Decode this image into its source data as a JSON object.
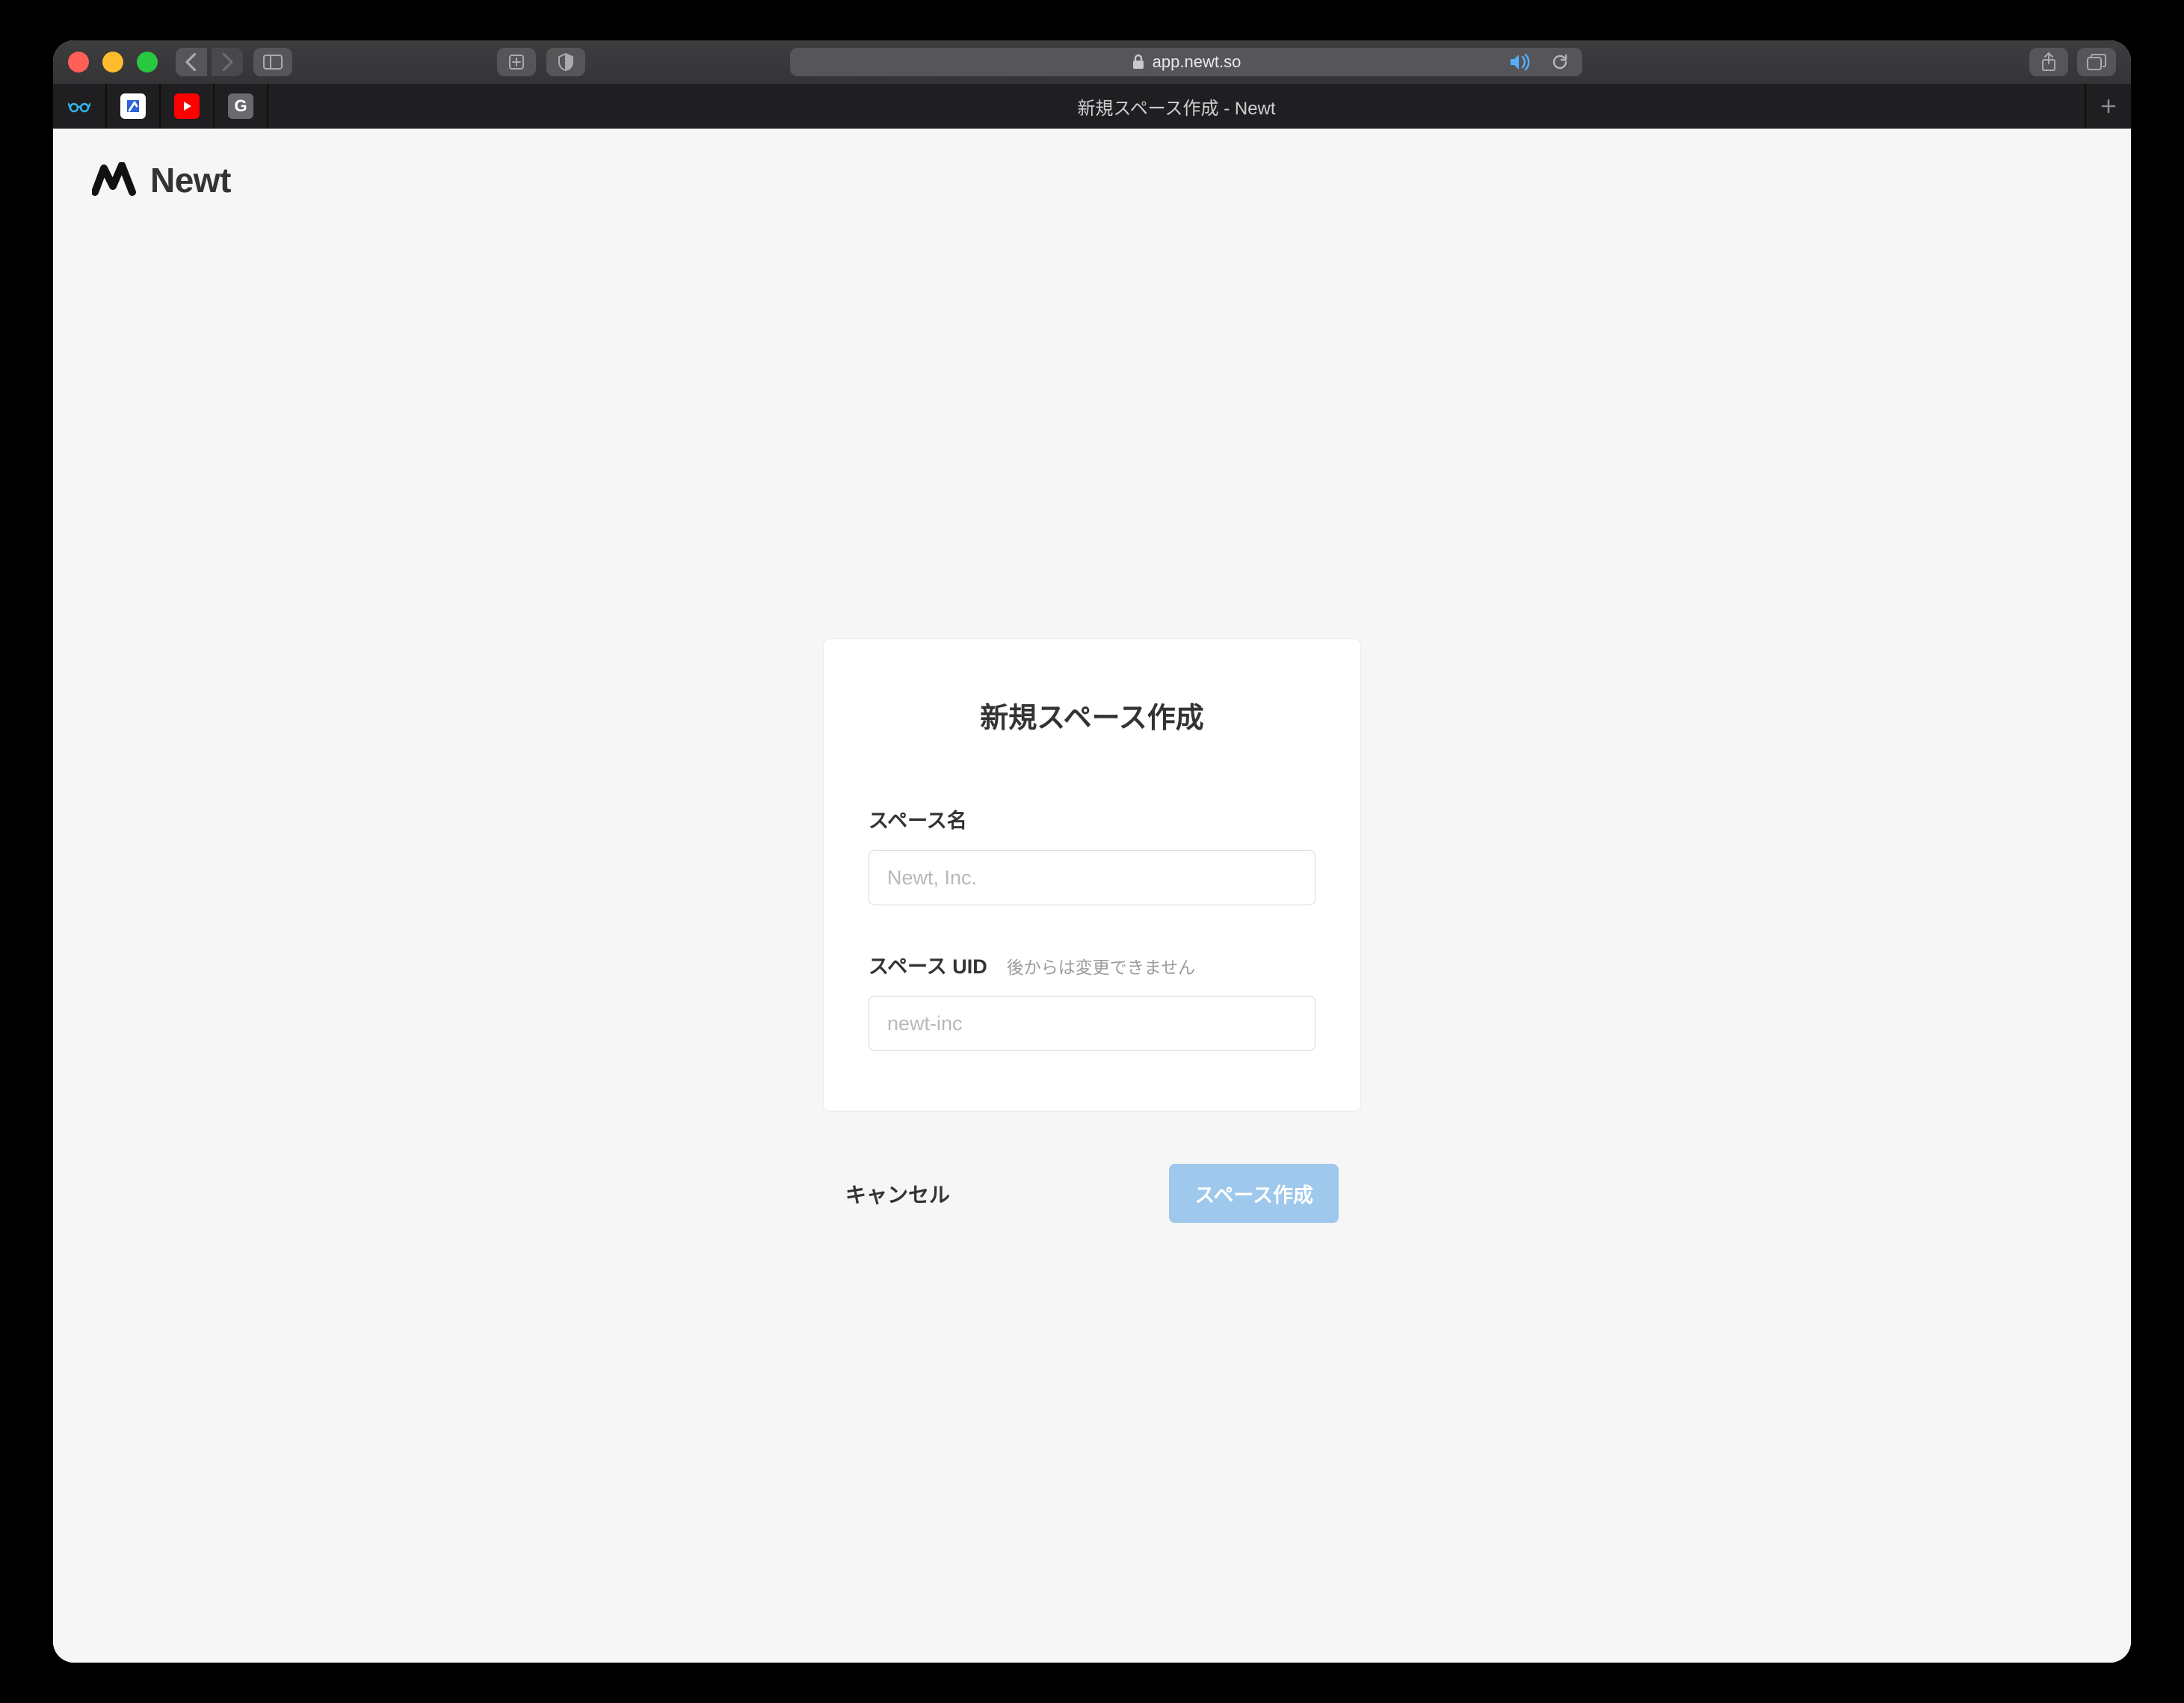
{
  "browser": {
    "url_host": "app.newt.so",
    "tab_title": "新規スペース作成 - Newt",
    "favorites": [
      "",
      "",
      "",
      "G"
    ]
  },
  "brand": {
    "name": "Newt"
  },
  "form": {
    "title": "新規スペース作成",
    "space_name": {
      "label": "スペース名",
      "placeholder": "Newt, Inc.",
      "value": ""
    },
    "space_uid": {
      "label": "スペース UID",
      "hint": "後からは変更できません",
      "placeholder": "newt-inc",
      "value": ""
    },
    "cancel_label": "キャンセル",
    "submit_label": "スペース作成"
  }
}
